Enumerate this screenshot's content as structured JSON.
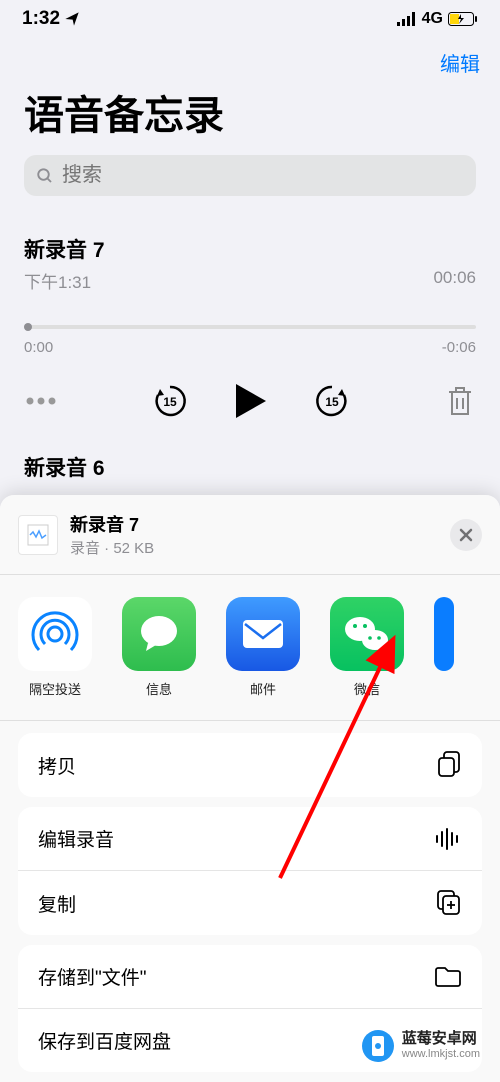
{
  "statusBar": {
    "time": "1:32",
    "network": "4G"
  },
  "navBar": {
    "edit": "编辑"
  },
  "title": "语音备忘录",
  "search": {
    "placeholder": "搜索"
  },
  "recording1": {
    "title": "新录音 7",
    "time": "下午1:31",
    "duration": "00:06",
    "posStart": "0:00",
    "posEnd": "-0:06"
  },
  "recording2": {
    "title": "新录音 6"
  },
  "share": {
    "fileName": "新录音 7",
    "fileMeta": "录音 · 52 KB",
    "apps": [
      {
        "label": "隔空投送",
        "bg": "#ffffff"
      },
      {
        "label": "信息",
        "bg": "#34c759"
      },
      {
        "label": "邮件",
        "bg": "#1b6fef"
      },
      {
        "label": "微信",
        "bg": "#07c160"
      },
      {
        "label": "",
        "bg": "#007aff"
      }
    ],
    "actions": {
      "copy": "拷贝",
      "edit": "编辑录音",
      "duplicate": "复制",
      "saveFiles": "存储到\"文件\"",
      "saveBaidu": "保存到百度网盘"
    }
  },
  "watermark": {
    "line1": "蓝莓安卓网",
    "line2": "www.lmkjst.com"
  }
}
